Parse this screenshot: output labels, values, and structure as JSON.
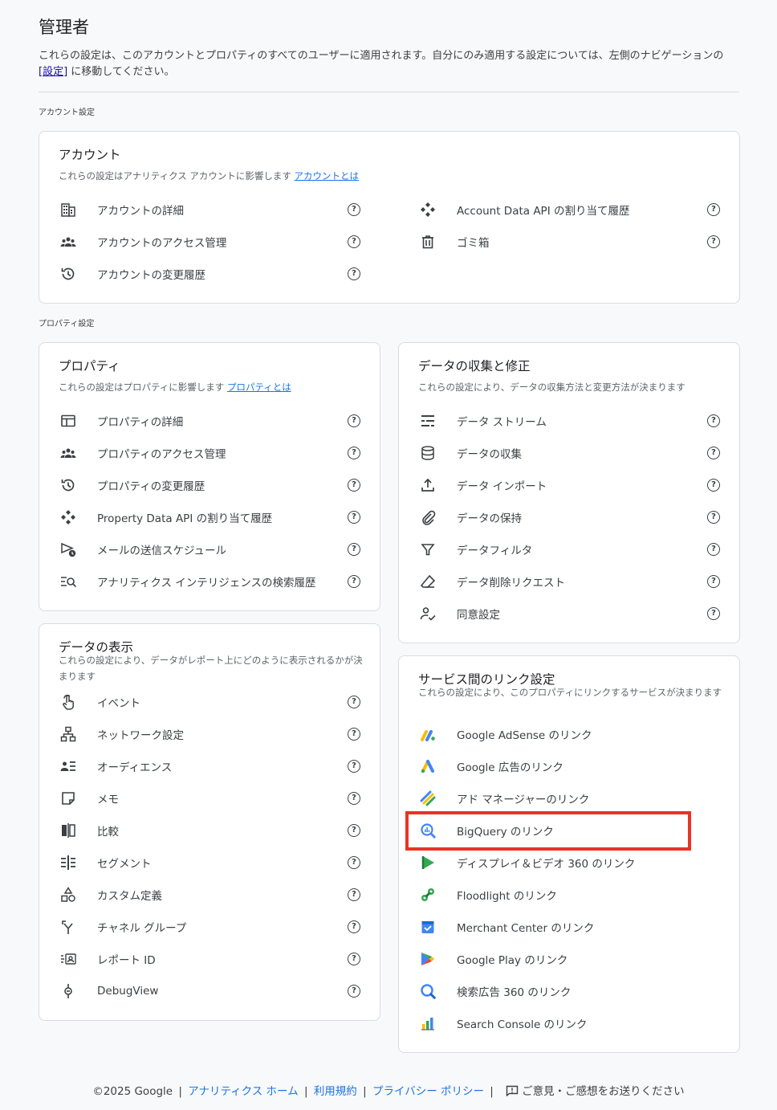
{
  "page": {
    "title": "管理者",
    "intro_before": "これらの設定は、このアカウントとプロパティのすべてのユーザーに適用されます。自分にのみ適用する設定については、左側のナビゲーションの ",
    "intro_link": "[設定]",
    "intro_after": " に移動してください。"
  },
  "account_section": {
    "label": "アカウント設定",
    "card": {
      "title": "アカウント",
      "desc": "これらの設定はアナリティクス アカウントに影響します ",
      "desc_link": "アカウントとは",
      "left_items": [
        {
          "label": "アカウントの詳細",
          "icon": "building-icon"
        },
        {
          "label": "アカウントのアクセス管理",
          "icon": "people-icon"
        },
        {
          "label": "アカウントの変更履歴",
          "icon": "history-icon"
        }
      ],
      "right_items": [
        {
          "label": "Account Data API の割り当て履歴",
          "icon": "api-icon"
        },
        {
          "label": "ゴミ箱",
          "icon": "trash-icon"
        }
      ]
    }
  },
  "property_section": {
    "label": "プロパティ設定",
    "property_card": {
      "title": "プロパティ",
      "desc": "これらの設定はプロパティに影響します ",
      "desc_link": "プロパティとは",
      "items": [
        {
          "label": "プロパティの詳細",
          "icon": "web-icon"
        },
        {
          "label": "プロパティのアクセス管理",
          "icon": "people-icon"
        },
        {
          "label": "プロパティの変更履歴",
          "icon": "history-icon"
        },
        {
          "label": "Property Data API の割り当て履歴",
          "icon": "api-icon"
        },
        {
          "label": "メールの送信スケジュール",
          "icon": "schedule-send-icon"
        },
        {
          "label": "アナリティクス インテリジェンスの検索履歴",
          "icon": "search-history-icon"
        }
      ]
    },
    "data_collection_card": {
      "title": "データの収集と修正",
      "desc": "これらの設定により、データの収集方法と変更方法が決まります",
      "items": [
        {
          "label": "データ ストリーム",
          "icon": "stream-icon"
        },
        {
          "label": "データの収集",
          "icon": "database-icon"
        },
        {
          "label": "データ インポート",
          "icon": "upload-icon"
        },
        {
          "label": "データの保持",
          "icon": "retention-icon"
        },
        {
          "label": "データフィルタ",
          "icon": "filter-icon"
        },
        {
          "label": "データ削除リクエスト",
          "icon": "eraser-icon"
        },
        {
          "label": "同意設定",
          "icon": "consent-icon"
        }
      ]
    },
    "data_display_card": {
      "title": "データの表示",
      "desc": "これらの設定により、データがレポート上にどのように表示されるかが決まります",
      "items": [
        {
          "label": "イベント",
          "icon": "touch-icon"
        },
        {
          "label": "ネットワーク設定",
          "icon": "network-icon"
        },
        {
          "label": "オーディエンス",
          "icon": "audience-icon"
        },
        {
          "label": "メモ",
          "icon": "note-icon"
        },
        {
          "label": "比較",
          "icon": "compare-icon"
        },
        {
          "label": "セグメント",
          "icon": "segment-icon"
        },
        {
          "label": "カスタム定義",
          "icon": "shapes-icon"
        },
        {
          "label": "チャネル グループ",
          "icon": "merge-icon"
        },
        {
          "label": "レポート ID",
          "icon": "report-id-icon"
        },
        {
          "label": "DebugView",
          "icon": "debug-icon"
        }
      ]
    },
    "service_links_card": {
      "title": "サービス間のリンク設定",
      "desc": "これらの設定により、このプロパティにリンクするサービスが決まります",
      "items": [
        {
          "label": "Google AdSense のリンク",
          "icon": "adsense-icon"
        },
        {
          "label": "Google 広告のリンク",
          "icon": "google-ads-icon"
        },
        {
          "label": "アド マネージャーのリンク",
          "icon": "ad-manager-icon"
        },
        {
          "label": "BigQuery のリンク",
          "icon": "bigquery-icon"
        },
        {
          "label": "ディスプレイ＆ビデオ 360 のリンク",
          "icon": "dv360-icon"
        },
        {
          "label": "Floodlight のリンク",
          "icon": "floodlight-icon"
        },
        {
          "label": "Merchant Center のリンク",
          "icon": "merchant-center-icon"
        },
        {
          "label": "Google Play のリンク",
          "icon": "google-play-icon"
        },
        {
          "label": "検索広告 360 のリンク",
          "icon": "sa360-icon"
        },
        {
          "label": "Search Console のリンク",
          "icon": "search-console-icon"
        }
      ]
    }
  },
  "help_glyph": "?",
  "footer": {
    "copyright": "©2025 Google",
    "sep": "|",
    "links": [
      "アナリティクス ホーム",
      "利用規約",
      "プライバシー ポリシー"
    ],
    "feedback": "ご意見・ご感想をお送りください"
  },
  "colors": {
    "highlight": "#ea3323",
    "link": "#1a73e8"
  }
}
